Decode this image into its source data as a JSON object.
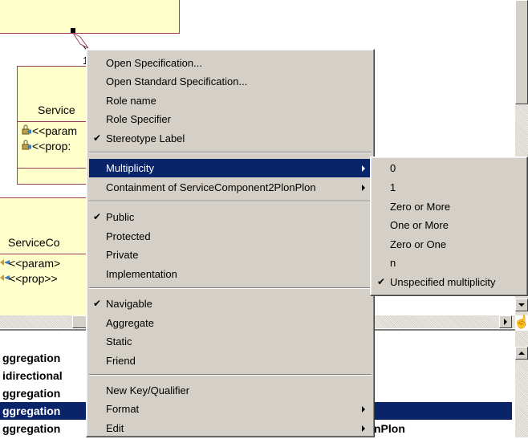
{
  "diagram": {
    "class_top": {
      "name": ""
    },
    "class_mid": {
      "name": "Service",
      "attributes": [
        "<<param",
        "<<prop:"
      ]
    },
    "class_bottom": {
      "name": "ServiceCo",
      "attributes": [
        "<<param>",
        "<<prop>>"
      ]
    },
    "role_label": "1"
  },
  "list": {
    "rows": [
      {
        "left": "ggregation",
        "right": ""
      },
      {
        "left": "idirectional",
        "right": ""
      },
      {
        "left": "ggregation",
        "right": ""
      },
      {
        "left": "ggregation",
        "right": ""
      },
      {
        "left": "ggregation",
        "right": "nPlon"
      }
    ],
    "selected_index": 3
  },
  "context_menu": {
    "groups": [
      [
        {
          "label": "Open Specification...",
          "checked": false,
          "submenu": false
        },
        {
          "label": "Open Standard Specification...",
          "checked": false,
          "submenu": false
        },
        {
          "label": "Role name",
          "checked": false,
          "submenu": false
        },
        {
          "label": "Role Specifier",
          "checked": false,
          "submenu": false
        },
        {
          "label": "Stereotype Label",
          "checked": true,
          "submenu": false
        }
      ],
      [
        {
          "label": "Multiplicity",
          "checked": false,
          "submenu": true,
          "highlighted": true
        },
        {
          "label": "Containment of ServiceComponent2PlonPlon",
          "checked": false,
          "submenu": true
        }
      ],
      [
        {
          "label": "Public",
          "checked": true,
          "submenu": false
        },
        {
          "label": "Protected",
          "checked": false,
          "submenu": false
        },
        {
          "label": "Private",
          "checked": false,
          "submenu": false
        },
        {
          "label": "Implementation",
          "checked": false,
          "submenu": false
        }
      ],
      [
        {
          "label": "Navigable",
          "checked": true,
          "submenu": false
        },
        {
          "label": "Aggregate",
          "checked": false,
          "submenu": false
        },
        {
          "label": "Static",
          "checked": false,
          "submenu": false
        },
        {
          "label": "Friend",
          "checked": false,
          "submenu": false
        }
      ],
      [
        {
          "label": "New Key/Qualifier",
          "checked": false,
          "submenu": false
        },
        {
          "label": "Format",
          "checked": false,
          "submenu": true
        },
        {
          "label": "Edit",
          "checked": false,
          "submenu": true
        }
      ]
    ]
  },
  "submenu": {
    "items": [
      {
        "label": "0",
        "checked": false
      },
      {
        "label": "1",
        "checked": false
      },
      {
        "label": "Zero or More",
        "checked": false
      },
      {
        "label": "One or More",
        "checked": false
      },
      {
        "label": "Zero or One",
        "checked": false
      },
      {
        "label": "n",
        "checked": false
      },
      {
        "label": "Unspecified multiplicity",
        "checked": true
      }
    ]
  },
  "colors": {
    "class_fill": "#ffffcc",
    "class_border": "#a04060",
    "highlight": "#0a246a",
    "menu_bg": "#d4d0c8"
  }
}
